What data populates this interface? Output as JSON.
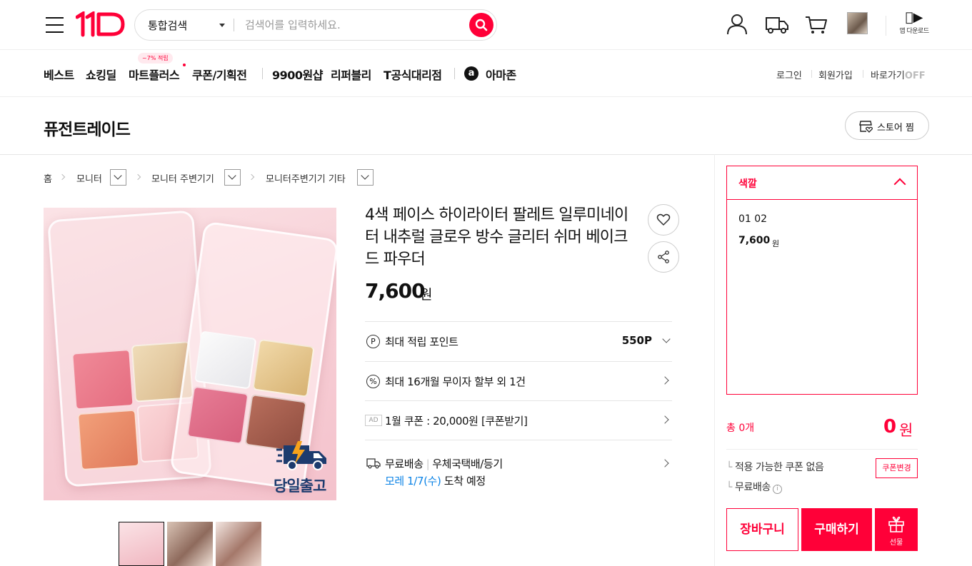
{
  "header": {
    "search_category": "통합검색",
    "search_placeholder": "검색어를 입력하세요.",
    "app_download": "앱 다운로드"
  },
  "nav": {
    "items": [
      "베스트",
      "쇼킹딜",
      "마트플러스",
      "쿠폰/기획전",
      "9900원샵",
      "리퍼블리",
      "T공식대리점",
      "아마존"
    ],
    "badge": "~7% 적립",
    "right": {
      "login": "로그인",
      "signup": "회원가입",
      "shortcut": "바로가기",
      "shortcut_state": "OFF"
    }
  },
  "store": {
    "name": "퓨전트레이드",
    "follow_label": "스토어 찜"
  },
  "breadcrumb": [
    "홈",
    "모니터",
    "모니터 주변기기",
    "모니터주변기기 기타"
  ],
  "product": {
    "title": "4색 페이스 하이라이터 팔레트 일루미네이터 내추럴 글로우 방수 글리터 쉬머 베이크드 파우더",
    "price": "7,600",
    "price_unit": "원",
    "image_caption": "당일출고",
    "rows": {
      "points_label": "최대 적립 포인트",
      "points_value": "550P",
      "installment": "최대 16개월 무이자 할부 외 1건",
      "ad_tag": "AD",
      "coupon": "1월 쿠폰 : 20,000원 [쿠폰받기]",
      "shipping_free": "무료배송",
      "shipping_method": "우체국택배/등기",
      "eta_date": "모레 1/7(수)",
      "eta_text": "도착 예정"
    }
  },
  "options": {
    "header": "색깔",
    "items": [
      {
        "name": "01 02",
        "price": "7,600",
        "unit": "원"
      }
    ]
  },
  "summary": {
    "total_label": "총 0개",
    "total_value": "0",
    "total_unit": "원",
    "coupon_status": "적용 가능한 쿠폰 없음",
    "coupon_change": "쿠폰변경",
    "free_shipping": "무료배송"
  },
  "actions": {
    "cart": "장바구니",
    "buy": "구매하기",
    "gift": "선물"
  },
  "colors": {
    "brand": "#ff0038",
    "link": "#0b83e6"
  }
}
